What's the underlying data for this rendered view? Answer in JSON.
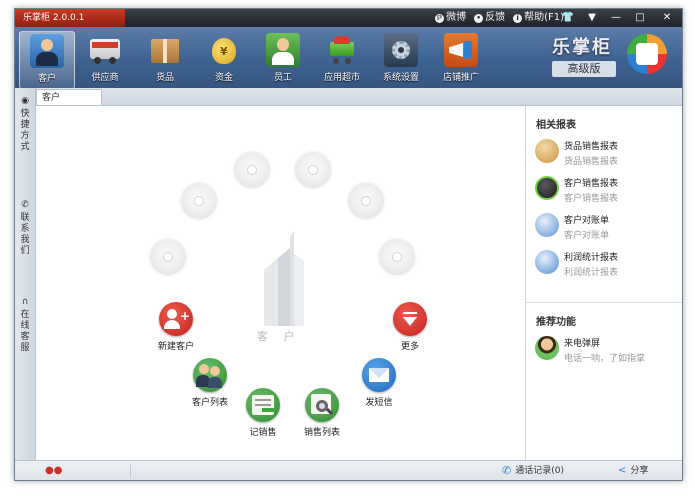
{
  "app": {
    "title": "乐掌柜 2.0.0.1"
  },
  "title_actions": [
    {
      "label": "微博"
    },
    {
      "label": "反馈"
    },
    {
      "label": "帮助(F1)"
    }
  ],
  "window_buttons": {
    "skin": "👕",
    "menu": "▼",
    "minimize": "—",
    "maximize": "□",
    "close": "✕"
  },
  "toolbar": {
    "items": [
      {
        "label": "客户",
        "active": true
      },
      {
        "label": "供应商"
      },
      {
        "label": "货品"
      },
      {
        "label": "资金"
      },
      {
        "label": "员工"
      },
      {
        "label": "应用超市"
      },
      {
        "label": "系统设置"
      },
      {
        "label": "店铺推广"
      }
    ],
    "brand": {
      "name": "乐掌柜",
      "edition": "高级版"
    }
  },
  "left_bar": [
    {
      "icon": "compass-icon",
      "glyph": "◉",
      "label": "快\n捷\n方\n式"
    },
    {
      "icon": "phone-icon",
      "glyph": "✆",
      "label": "联\n系\n我\n们"
    },
    {
      "icon": "headset-icon",
      "glyph": "∩",
      "label": "在\n线\n客\n服"
    }
  ],
  "tab": {
    "label": "客户"
  },
  "hub": {
    "center_label": "客 户",
    "actions": [
      {
        "label": "新建客户",
        "color": "#d2322d"
      },
      {
        "label": "客户列表",
        "color": "#3c9a3c"
      },
      {
        "label": "记销售",
        "color": "#3c9a3c"
      },
      {
        "label": "销售列表",
        "color": "#3c9a3c"
      },
      {
        "label": "发短信",
        "color": "#2f7fd1"
      },
      {
        "label": "更多",
        "color": "#d2322d"
      }
    ]
  },
  "right_panel": {
    "reports_title": "相关报表",
    "reports": [
      {
        "title": "货品销售报表",
        "subtitle": "货品销售报表"
      },
      {
        "title": "客户销售报表",
        "subtitle": "客户销售报表"
      },
      {
        "title": "客户对账单",
        "subtitle": "客户对账单"
      },
      {
        "title": "利润统计报表",
        "subtitle": "利润统计报表"
      }
    ],
    "recommend_title": "推荐功能",
    "recommend": [
      {
        "title": "来电弹屏",
        "subtitle": "电话一响，了如指掌"
      }
    ]
  },
  "status_bar": {
    "call_log": "通话记录(0)",
    "share": "分享"
  }
}
